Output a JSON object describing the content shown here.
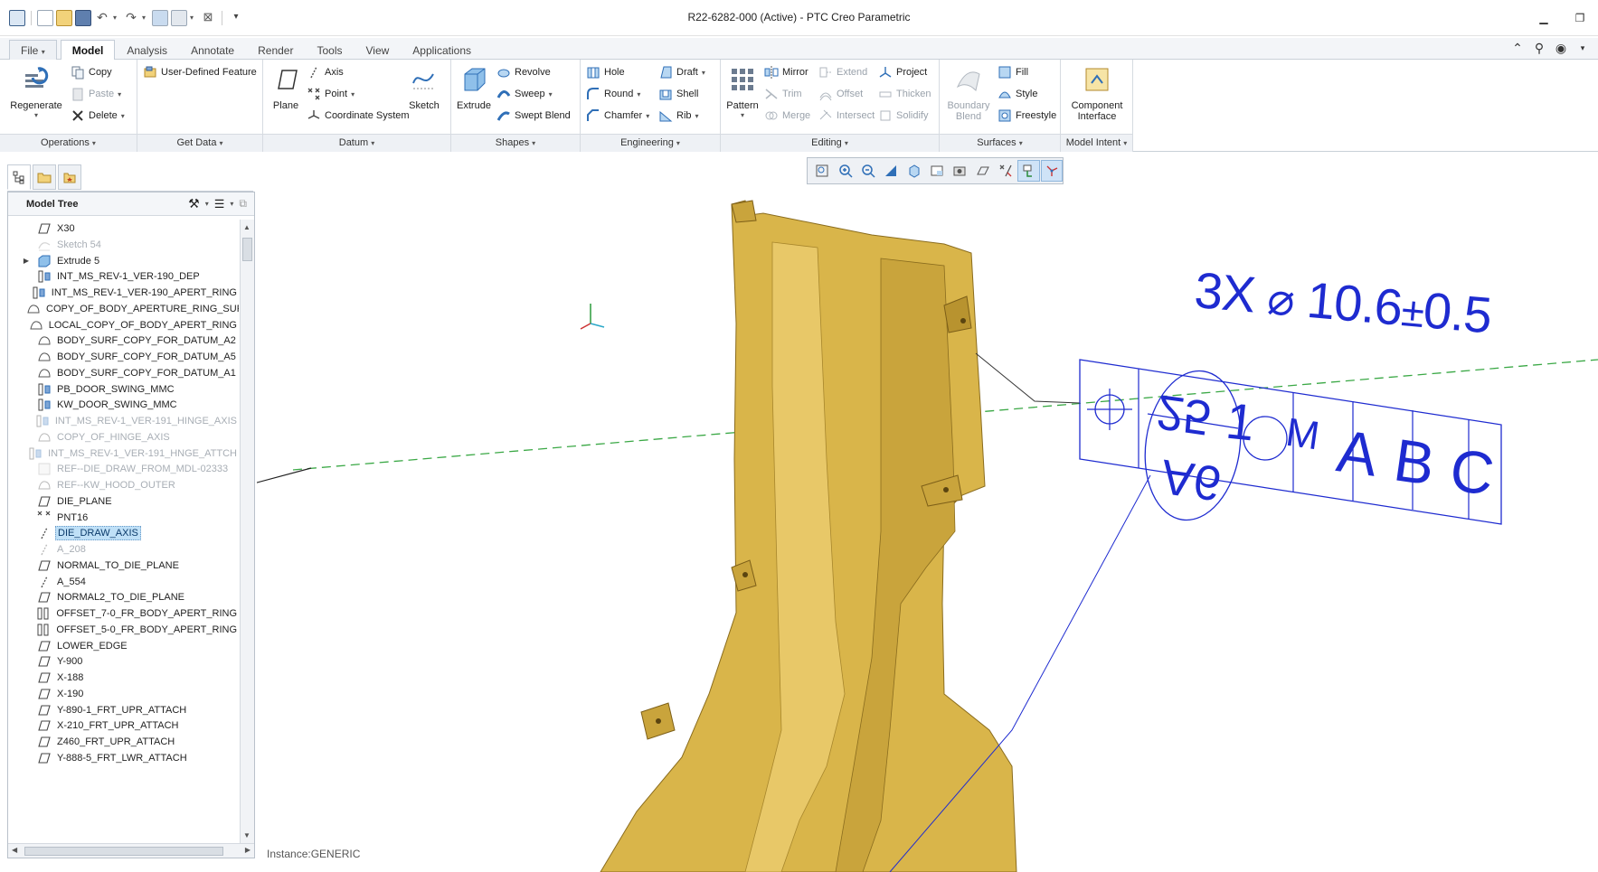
{
  "window": {
    "title": "R22-6282-000 (Active) - PTC Creo Parametric"
  },
  "tabs": [
    {
      "label": "File",
      "caret": "▾"
    },
    {
      "label": "Model"
    },
    {
      "label": "Analysis"
    },
    {
      "label": "Annotate"
    },
    {
      "label": "Render"
    },
    {
      "label": "Tools"
    },
    {
      "label": "View"
    },
    {
      "label": "Applications"
    }
  ],
  "ribbon": {
    "regenerate": "Regenerate",
    "copy": "Copy",
    "paste": "Paste",
    "delete": "Delete",
    "user_defined_feature": "User-Defined Feature",
    "plane": "Plane",
    "axis": "Axis",
    "point": "Point",
    "coordinate_system": "Coordinate System",
    "sketch": "Sketch",
    "extrude": "Extrude",
    "revolve": "Revolve",
    "sweep": "Sweep",
    "swept_blend": "Swept Blend",
    "hole": "Hole",
    "round": "Round",
    "chamfer": "Chamfer",
    "draft": "Draft",
    "shell": "Shell",
    "rib": "Rib",
    "pattern": "Pattern",
    "mirror": "Mirror",
    "trim": "Trim",
    "merge": "Merge",
    "extend": "Extend",
    "offset": "Offset",
    "intersect": "Intersect",
    "project": "Project",
    "thicken": "Thicken",
    "solidify": "Solidify",
    "boundary_blend_1": "Boundary",
    "boundary_blend_2": "Blend",
    "fill": "Fill",
    "style": "Style",
    "freestyle": "Freestyle",
    "component_interface_1": "Component",
    "component_interface_2": "Interface",
    "groups": {
      "operations": "Operations",
      "get_data": "Get Data",
      "datum": "Datum",
      "shapes": "Shapes",
      "engineering": "Engineering",
      "editing": "Editing",
      "surfaces": "Surfaces",
      "model_intent": "Model Intent"
    }
  },
  "tree": {
    "title": "Model Tree",
    "items": [
      {
        "label": "X30",
        "icon": "datum-plane-icon",
        "state": "normal"
      },
      {
        "label": "Sketch 54",
        "icon": "sketch-icon",
        "state": "faded"
      },
      {
        "label": "Extrude 5",
        "icon": "extrude-icon",
        "state": "normal",
        "expandable": true
      },
      {
        "label": "INT_MS_REV-1_VER-190_DEP",
        "icon": "copy-geom-icon",
        "state": "normal"
      },
      {
        "label": "INT_MS_REV-1_VER-190_APERT_RING",
        "icon": "copy-geom-icon",
        "state": "normal"
      },
      {
        "label": "COPY_OF_BODY_APERTURE_RING_SUR",
        "icon": "surface-copy-icon",
        "state": "normal"
      },
      {
        "label": "LOCAL_COPY_OF_BODY_APERT_RING",
        "icon": "surface-copy-icon",
        "state": "normal"
      },
      {
        "label": "BODY_SURF_COPY_FOR_DATUM_A2",
        "icon": "surface-copy-icon",
        "state": "normal"
      },
      {
        "label": "BODY_SURF_COPY_FOR_DATUM_A5",
        "icon": "surface-copy-icon",
        "state": "normal"
      },
      {
        "label": "BODY_SURF_COPY_FOR_DATUM_A1",
        "icon": "surface-copy-icon",
        "state": "normal"
      },
      {
        "label": "PB_DOOR_SWING_MMC",
        "icon": "copy-geom-icon",
        "state": "normal"
      },
      {
        "label": "KW_DOOR_SWING_MMC",
        "icon": "copy-geom-icon",
        "state": "normal"
      },
      {
        "label": "INT_MS_REV-1_VER-191_HINGE_AXIS",
        "icon": "copy-geom-icon",
        "state": "faded"
      },
      {
        "label": "COPY_OF_HINGE_AXIS",
        "icon": "surface-copy-icon",
        "state": "faded"
      },
      {
        "label": "INT_MS_REV-1_VER-191_HNGE_ATTCH",
        "icon": "copy-geom-icon",
        "state": "faded"
      },
      {
        "label": "REF--DIE_DRAW_FROM_MDL-02333",
        "icon": "reference-icon",
        "state": "faded"
      },
      {
        "label": "REF--KW_HOOD_OUTER",
        "icon": "surface-copy-icon",
        "state": "faded"
      },
      {
        "label": "DIE_PLANE",
        "icon": "datum-plane-icon",
        "state": "normal"
      },
      {
        "label": "PNT16",
        "icon": "datum-point-icon",
        "state": "normal"
      },
      {
        "label": "DIE_DRAW_AXIS",
        "icon": "datum-axis-icon",
        "state": "selected"
      },
      {
        "label": "A_208",
        "icon": "datum-axis-icon",
        "state": "faded"
      },
      {
        "label": "NORMAL_TO_DIE_PLANE",
        "icon": "datum-plane-icon",
        "state": "normal"
      },
      {
        "label": "A_554",
        "icon": "datum-axis-icon",
        "state": "normal"
      },
      {
        "label": "NORMAL2_TO_DIE_PLANE",
        "icon": "datum-plane-icon",
        "state": "normal"
      },
      {
        "label": "OFFSET_7-0_FR_BODY_APERT_RING",
        "icon": "offset-icon",
        "state": "normal"
      },
      {
        "label": "OFFSET_5-0_FR_BODY_APERT_RING",
        "icon": "offset-icon",
        "state": "normal"
      },
      {
        "label": "LOWER_EDGE",
        "icon": "datum-plane-icon",
        "state": "normal"
      },
      {
        "label": "Y-900",
        "icon": "datum-plane-icon",
        "state": "normal"
      },
      {
        "label": "X-188",
        "icon": "datum-plane-icon",
        "state": "normal"
      },
      {
        "label": "X-190",
        "icon": "datum-plane-icon",
        "state": "normal"
      },
      {
        "label": "Y-890-1_FRT_UPR_ATTACH",
        "icon": "datum-plane-icon",
        "state": "normal"
      },
      {
        "label": "X-210_FRT_UPR_ATTACH",
        "icon": "datum-plane-icon",
        "state": "normal"
      },
      {
        "label": "Z460_FRT_UPR_ATTACH",
        "icon": "datum-plane-icon",
        "state": "normal"
      },
      {
        "label": "Y-888-5_FRT_LWR_ATTACH",
        "icon": "datum-plane-icon",
        "state": "normal"
      }
    ]
  },
  "annotation": {
    "count": "3X",
    "diameter_symbol": "⌀",
    "value": "10.6",
    "tolerance_symbol": "±",
    "tolerance": "0.5",
    "mmc": "M",
    "datum_a": "A",
    "datum_b": "B",
    "datum_c": "C",
    "datum_target_1": "25",
    "datum_target_2": "1",
    "datum_target_3": "A6"
  },
  "viewport": {
    "instance": "Instance:GENERIC"
  },
  "colors": {
    "part": "#d9b54a",
    "annotation": "#1e2bd0",
    "axis_line": "#3aa845"
  }
}
